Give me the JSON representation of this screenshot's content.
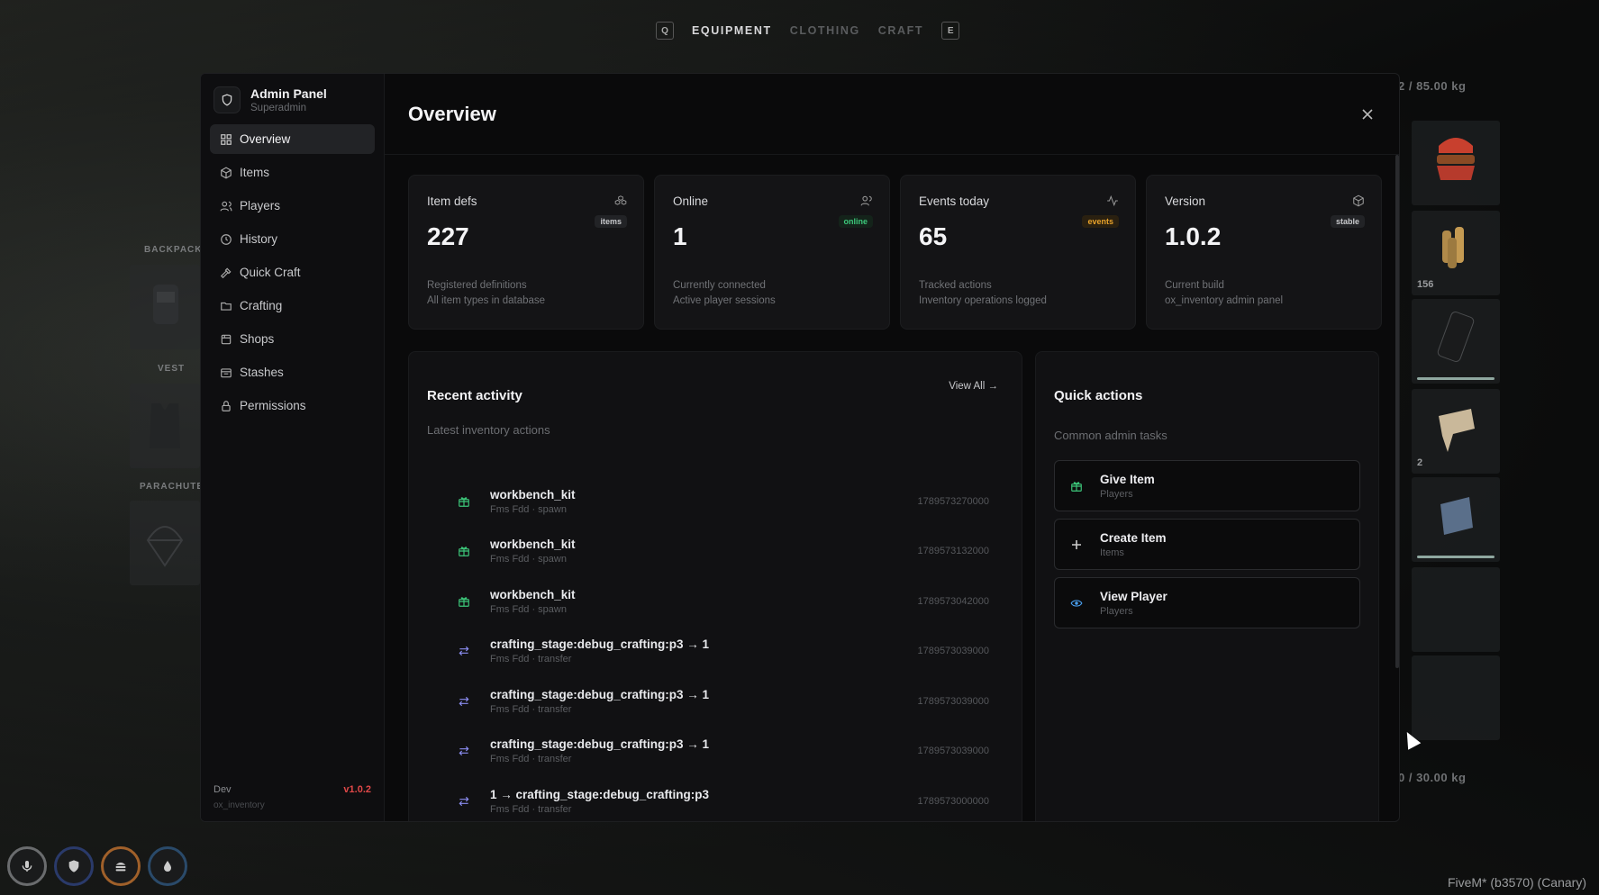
{
  "top_tabs": {
    "left_key": "Q",
    "right_key": "E",
    "items": [
      "EQUIPMENT",
      "CLOTHING",
      "CRAFT"
    ]
  },
  "game_slots": {
    "backpack": "BACKPACK",
    "vest": "VEST",
    "parachute": "PARACHUTE"
  },
  "right_inventory": {
    "weight_top": "2 / 85.00 kg",
    "weight_bottom": "0 / 30.00 kg",
    "counts": [
      "156",
      "2"
    ]
  },
  "sidebar": {
    "title": "Admin Panel",
    "subtitle": "Superadmin",
    "items": [
      {
        "label": "Overview",
        "icon": "grid-icon"
      },
      {
        "label": "Items",
        "icon": "box-icon"
      },
      {
        "label": "Players",
        "icon": "users-icon"
      },
      {
        "label": "History",
        "icon": "clock-icon"
      },
      {
        "label": "Quick Craft",
        "icon": "hammer-icon"
      },
      {
        "label": "Crafting",
        "icon": "folder-icon"
      },
      {
        "label": "Shops",
        "icon": "shop-icon"
      },
      {
        "label": "Stashes",
        "icon": "stash-icon"
      },
      {
        "label": "Permissions",
        "icon": "lock-icon"
      }
    ],
    "footer": {
      "env": "Dev",
      "version": "v1.0.2",
      "resource": "ox_inventory"
    }
  },
  "main": {
    "title": "Overview"
  },
  "stats": [
    {
      "label": "Item defs",
      "value": "227",
      "badge": "items",
      "desc1": "Registered definitions",
      "desc2": "All item types in database"
    },
    {
      "label": "Online",
      "value": "1",
      "badge": "online",
      "desc1": "Currently connected",
      "desc2": "Active player sessions"
    },
    {
      "label": "Events today",
      "value": "65",
      "badge": "events",
      "desc1": "Tracked actions",
      "desc2": "Inventory operations logged"
    },
    {
      "label": "Version",
      "value": "1.0.2",
      "badge": "stable",
      "desc1": "Current build",
      "desc2": "ox_inventory admin panel"
    }
  ],
  "activity": {
    "title": "Recent activity",
    "subtitle": "Latest inventory actions",
    "view_all": "View All →",
    "rows": [
      {
        "name": "workbench_kit",
        "meta": "Fms Fdd · spawn",
        "time": "1789573270000",
        "kind": "spawn"
      },
      {
        "name": "workbench_kit",
        "meta": "Fms Fdd · spawn",
        "time": "1789573132000",
        "kind": "spawn"
      },
      {
        "name": "workbench_kit",
        "meta": "Fms Fdd · spawn",
        "time": "1789573042000",
        "kind": "spawn"
      },
      {
        "name": "crafting_stage:debug_crafting:p3 → 1",
        "meta": "Fms Fdd · transfer",
        "time": "1789573039000",
        "kind": "transfer"
      },
      {
        "name": "crafting_stage:debug_crafting:p3 → 1",
        "meta": "Fms Fdd · transfer",
        "time": "1789573039000",
        "kind": "transfer"
      },
      {
        "name": "crafting_stage:debug_crafting:p3 → 1",
        "meta": "Fms Fdd · transfer",
        "time": "1789573039000",
        "kind": "transfer"
      },
      {
        "name": "1 → crafting_stage:debug_crafting:p3",
        "meta": "Fms Fdd · transfer",
        "time": "1789573000000",
        "kind": "transfer"
      }
    ]
  },
  "quick_actions": {
    "title": "Quick actions",
    "subtitle": "Common admin tasks",
    "items": [
      {
        "title": "Give Item",
        "sub": "Players"
      },
      {
        "title": "Create Item",
        "sub": "Items"
      },
      {
        "title": "View Player",
        "sub": "Players"
      }
    ]
  },
  "status_bar": {
    "fivem": "FiveM* (b3570) (Canary)"
  },
  "colors": {
    "accent_green": "#3cc77a",
    "accent_orange": "#e8a22a",
    "version_red": "#e04848",
    "transfer_purple": "#8a8cf0"
  }
}
